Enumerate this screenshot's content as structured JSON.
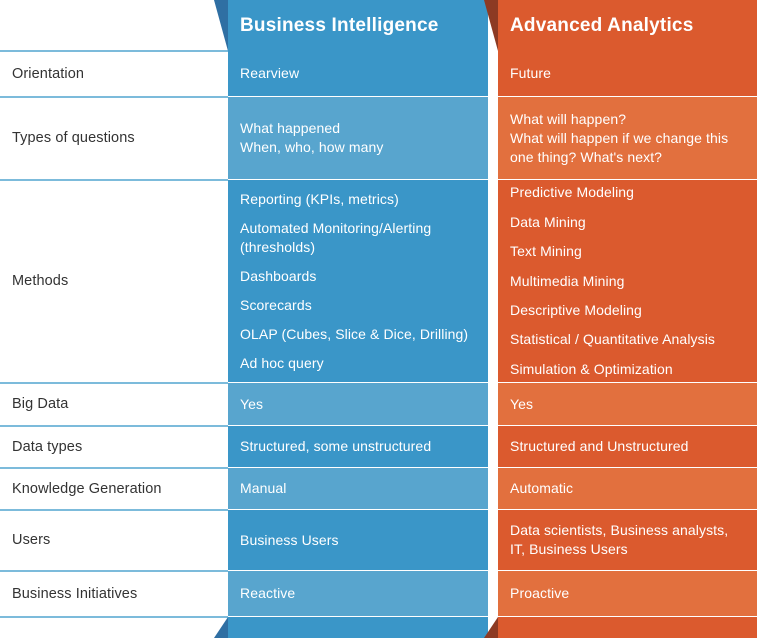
{
  "table": {
    "columns": [
      {
        "key": "labels",
        "header": ""
      },
      {
        "key": "bi",
        "header": "Business Intelligence",
        "color": "#3A96C8",
        "color_alt": "#58A5CE",
        "fold_color": "#2F6FA3"
      },
      {
        "key": "aa",
        "header": "Advanced Analytics",
        "color": "#DB5A2E",
        "color_alt": "#E2703E",
        "fold_color": "#8D3A23"
      }
    ],
    "rows": [
      {
        "label": "Orientation",
        "bi": "Rearview",
        "aa": "Future"
      },
      {
        "label": "Types of questions",
        "bi": "What happened\nWhen, who, how many",
        "aa": "What  will happen?\nWhat will happen if we change this\none thing? What's next?"
      },
      {
        "label": "Methods",
        "bi_list": [
          "Reporting (KPIs, metrics)",
          "Automated Monitoring/Alerting\n(thresholds)",
          "Dashboards",
          "Scorecards",
          "OLAP (Cubes, Slice & Dice, Drilling)",
          "Ad hoc query"
        ],
        "aa_list": [
          "Predictive Modeling",
          "Data Mining",
          "Text Mining",
          "Multimedia Mining",
          "Descriptive Modeling",
          "Statistical / Quantitative Analysis",
          "Simulation & Optimization"
        ]
      },
      {
        "label": "Big Data",
        "bi": "Yes",
        "aa": "Yes"
      },
      {
        "label": "Data types",
        "bi": "Structured, some unstructured",
        "aa": "Structured and Unstructured"
      },
      {
        "label": "Knowledge Generation",
        "bi": "Manual",
        "aa": "Automatic"
      },
      {
        "label": "Users",
        "bi": "Business Users",
        "aa": "Data scientists, Business analysts,\nIT, Business Users"
      },
      {
        "label": "Business Initiatives",
        "bi": "Reactive",
        "aa": "Proactive"
      }
    ]
  }
}
